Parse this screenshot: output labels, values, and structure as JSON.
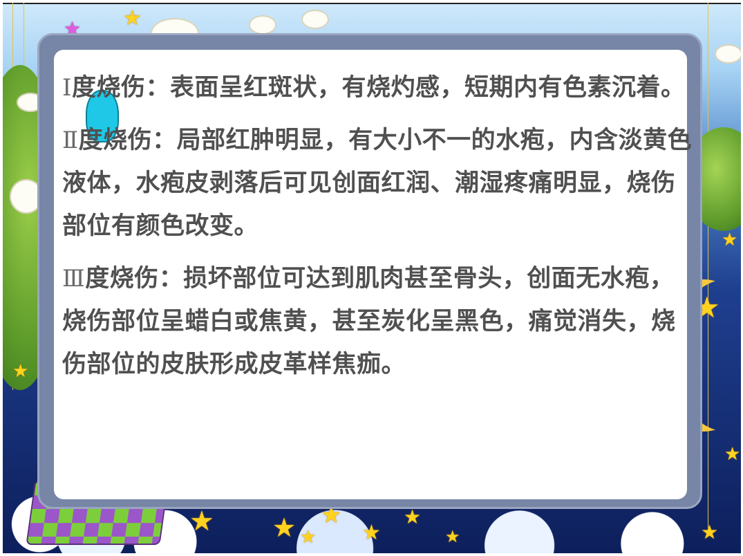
{
  "slide": {
    "colors": {
      "sky_top": "#cfe9fb",
      "night": "#0d1f5c",
      "frame": "#7786a6",
      "card": "#ffffff",
      "text": "#505050",
      "star": "#ffd21f",
      "star_pink": "#e25be0"
    },
    "paragraphs": [
      {
        "numeral": "Ⅰ",
        "text": "度烧伤：表面呈红斑状，有烧灼感，短期内有色素沉着。"
      },
      {
        "numeral": "Ⅱ",
        "text": "度烧伤：局部红肿明显，有大小不一的水疱，内含淡黄色液体，水疱皮剥落后可见创面红润、潮湿疼痛明显，烧伤部位有颜色改变。"
      },
      {
        "numeral": "Ⅲ",
        "text": "度烧伤：损坏部位可达到肌肉甚至骨头，创面无水疱，烧伤部位呈蜡白或焦黄，甚至炭化呈黑色，痛觉消失，烧伤部位的皮肤形成皮革样焦痂。"
      }
    ],
    "decorations": {
      "icons": [
        "star-icon",
        "sheep-icon",
        "moon-icon",
        "cloud-icon",
        "sleeping-child-icon",
        "mascot-icon"
      ]
    }
  }
}
